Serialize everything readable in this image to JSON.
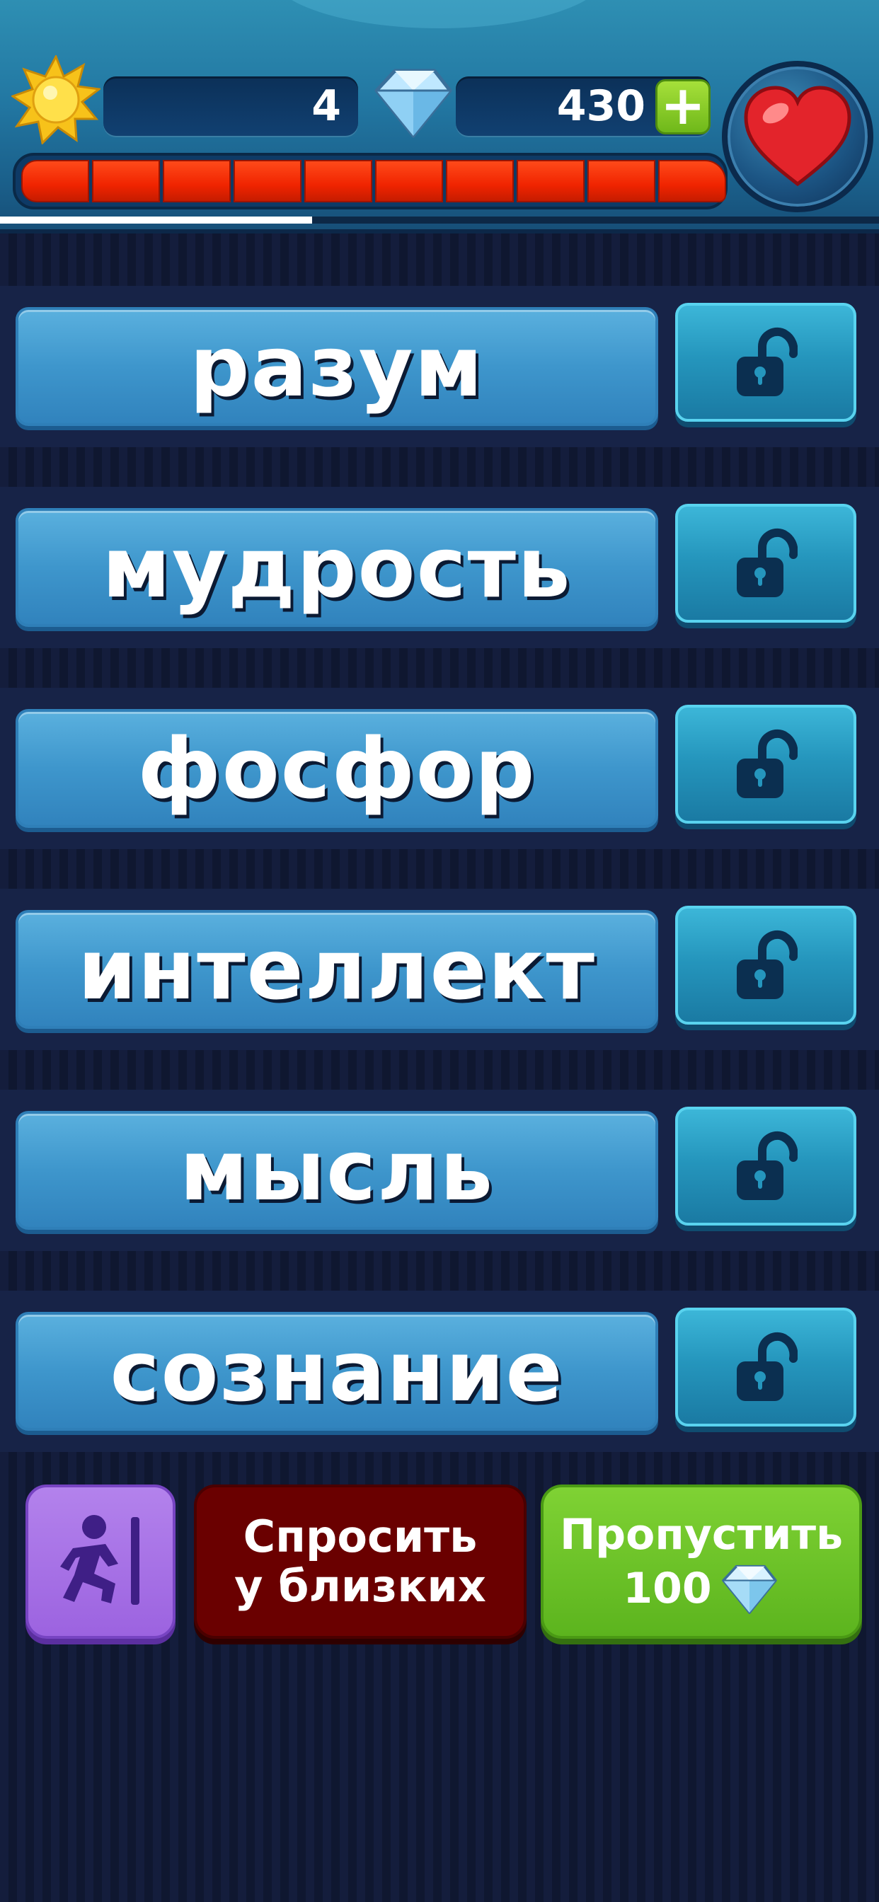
{
  "header": {
    "level": "4",
    "gems": "430",
    "plus_label": "+",
    "health_segments": 10,
    "level_progress": 0.355,
    "icons": [
      "sun-icon",
      "diamond-icon",
      "heart-icon"
    ]
  },
  "words": [
    {
      "label": "разум",
      "locked": false
    },
    {
      "label": "мудрость",
      "locked": false
    },
    {
      "label": "фосфор",
      "locked": false
    },
    {
      "label": "интеллект",
      "locked": false
    },
    {
      "label": "мысль",
      "locked": false
    },
    {
      "label": "сознание",
      "locked": false
    }
  ],
  "actions": {
    "exit_icon": "exit-icon",
    "ask_line1": "Спросить",
    "ask_line2": "у близких",
    "skip_label": "Пропустить",
    "skip_cost": "100"
  },
  "colors": {
    "word_button": "#3e96cc",
    "lock_button": "#2596bd",
    "health": "#f02400",
    "ask_button": "#6a0000",
    "skip_button": "#5cb41e",
    "exit_button": "#9c63e0"
  }
}
